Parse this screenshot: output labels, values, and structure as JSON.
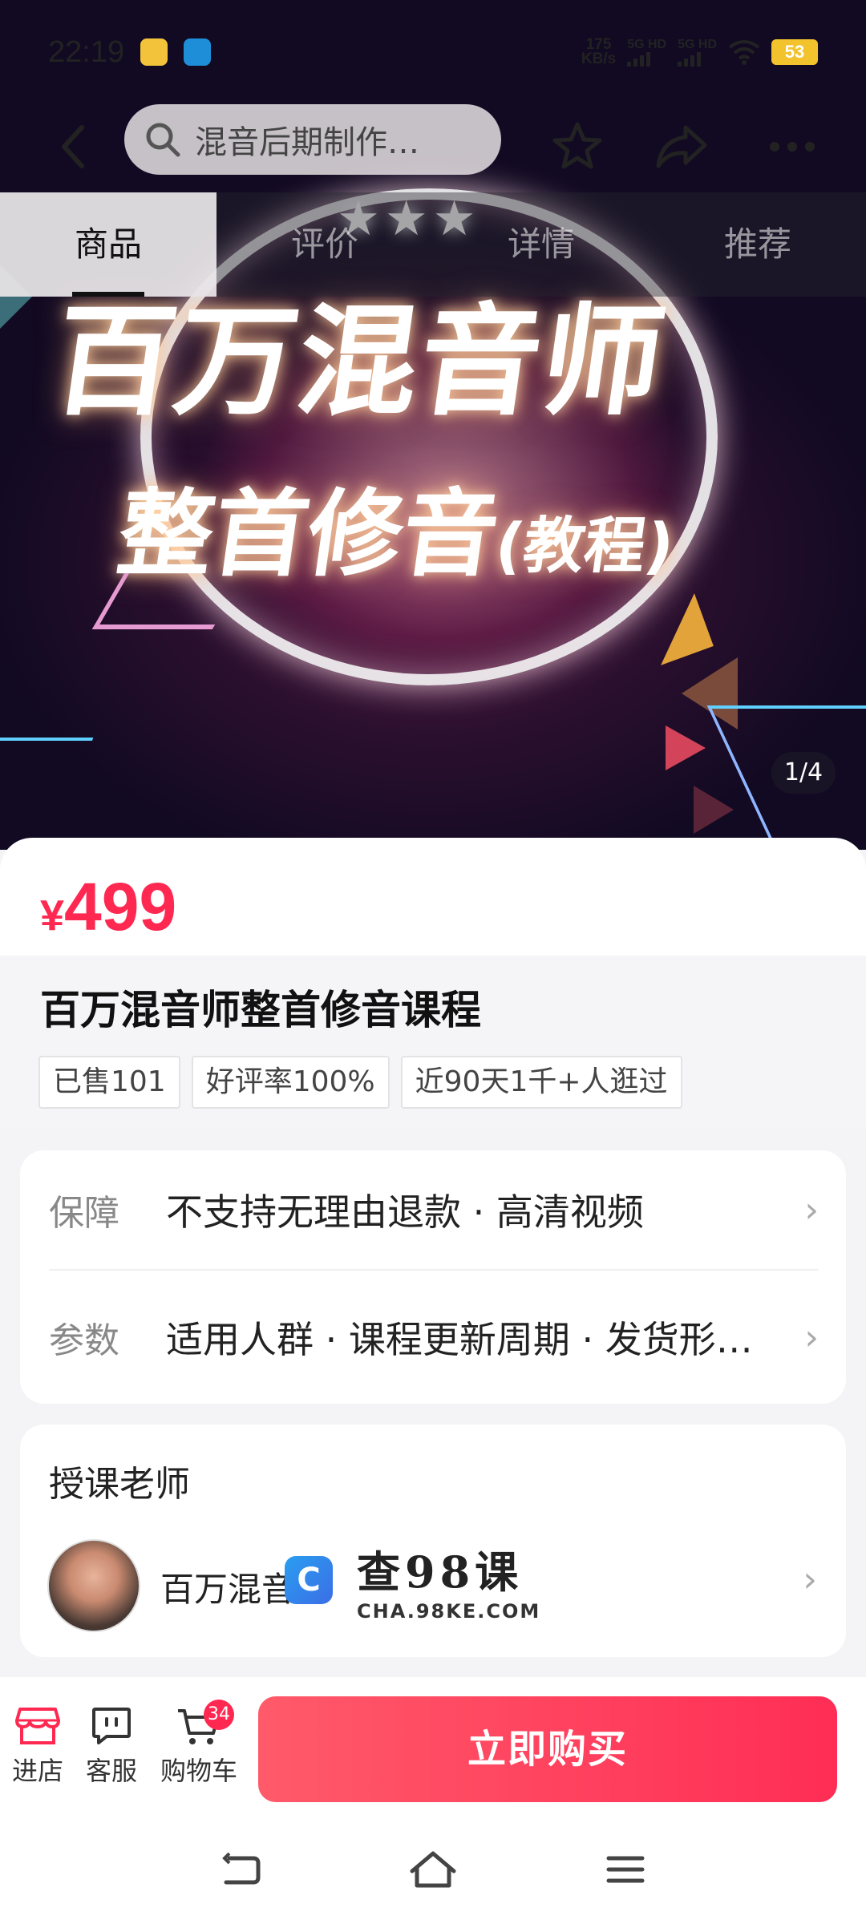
{
  "status_bar": {
    "time": "22:19",
    "net_speed_value": "175",
    "net_speed_unit": "KB/s",
    "sim1": "5G HD",
    "sim2": "5G HD",
    "battery": "53"
  },
  "top_nav": {
    "search_text": "混音后期制作…"
  },
  "section_tabs": [
    "商品",
    "评价",
    "详情",
    "推荐"
  ],
  "hero": {
    "title": "百万混音师",
    "subtitle": "整首修音",
    "subtitle_suffix": "(教程)",
    "stars": "★★★",
    "counter": "1/4"
  },
  "product": {
    "currency": "¥",
    "price": "499",
    "title": "百万混音师整首修音课程",
    "tags": [
      "已售101",
      "好评率100%",
      "近90天1千+人逛过"
    ]
  },
  "attributes": [
    {
      "label": "保障",
      "value": "不支持无理由退款 · 高清视频"
    },
    {
      "label": "参数",
      "value": "适用人群 · 课程更新周期 · 发货形…"
    }
  ],
  "teacher": {
    "heading": "授课老师",
    "name": "百万混音师"
  },
  "watermark": {
    "brand": "查98课",
    "url": "CHA.98KE.COM"
  },
  "bottom_bar": {
    "store_label": "进店",
    "service_label": "客服",
    "cart_label": "购物车",
    "cart_count": "34",
    "buy_label": "立即购买"
  },
  "colors": {
    "accent": "#ff2851",
    "buy_button": "#ff2d55"
  }
}
